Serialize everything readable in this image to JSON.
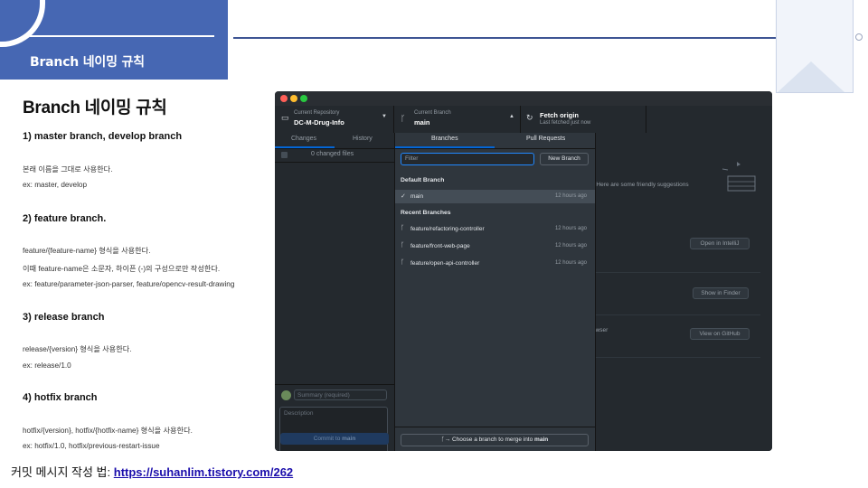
{
  "header": {
    "title": "Branch 네이밍 규칙"
  },
  "content": {
    "heading": "Branch 네이밍 규칙",
    "sections": [
      {
        "title": "1) master branch, develop branch",
        "lines": [
          "본래 이름을 그대로 사용한다.",
          "ex: master, develop"
        ]
      },
      {
        "title": "2) feature branch.",
        "lines": [
          "feature/{feature-name}  형식을 사용한다.",
          "이때 feature-name은 소문자, 하이픈 (-)의 구성으로만 작성한다.",
          "ex: feature/parameter-json-parser, feature/opencv-result-drawing"
        ]
      },
      {
        "title": "3) release branch",
        "lines": [
          "release/{version} 형식을 사용한다.",
          "ex: release/1.0"
        ]
      },
      {
        "title": "4) hotfix branch",
        "lines": [
          "hotfix/{version}, hotfix/{hotfix-name} 형식을 사용한다.",
          "ex: hotfix/1.0, hotfix/previous-restart-issue"
        ]
      }
    ],
    "note_prefix": "커밋 메시지 작성 법: ",
    "note_link": "https://suhanlim.tistory.com/262"
  },
  "app": {
    "toolbar": {
      "repo_label": "Current Repository",
      "repo_name": "DC-M-Drug-Info",
      "branch_label": "Current Branch",
      "branch_name": "main",
      "fetch_title": "Fetch origin",
      "fetch_sub": "Last fetched just now"
    },
    "sidebar": {
      "tab_changes": "Changes",
      "tab_history": "History",
      "changed_files": "0 changed files",
      "summary_placeholder": "Summary (required)",
      "description_placeholder": "Description",
      "coauthor_icon": "person-plus-icon",
      "commit_prefix": "Commit to ",
      "commit_branch": "main"
    },
    "main": {
      "suggest_text": "y. Here are some friendly suggestions",
      "open_intellij": "Open in IntelliJ",
      "show_finder": "Show in Finder",
      "browser_text": "owser",
      "view_github": "View on GitHub"
    },
    "dropdown": {
      "tab_branches": "Branches",
      "tab_pulls": "Pull Requests",
      "filter_placeholder": "Filter",
      "new_branch": "New Branch",
      "default_header": "Default Branch",
      "default_branch": {
        "name": "main",
        "time": "12 hours ago"
      },
      "recent_header": "Recent Branches",
      "recent": [
        {
          "name": "feature/refactoring-controller",
          "time": "12 hours ago"
        },
        {
          "name": "feature/front-web-page",
          "time": "12 hours ago"
        },
        {
          "name": "feature/open-api-controller",
          "time": "12 hours ago"
        }
      ],
      "merge_prefix": "Choose a branch to merge into ",
      "merge_branch": "main"
    }
  },
  "colors": {
    "accent": "#4667b3",
    "app_bg": "#24292e",
    "selection_blue": "#0366d6"
  }
}
